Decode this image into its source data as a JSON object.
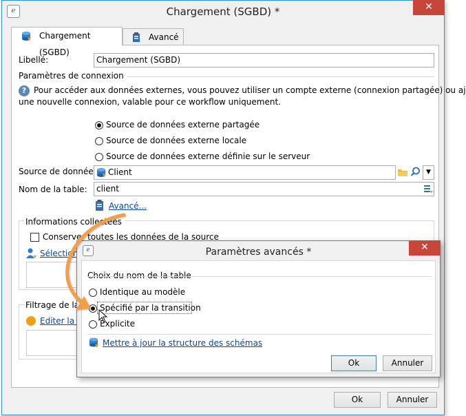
{
  "main_window": {
    "title": "Chargement (SGBD) *",
    "close_glyph": "✕",
    "tabs": [
      {
        "label": "Chargement (SGBD)",
        "icon": "database-icon"
      },
      {
        "label": "Avancé",
        "icon": "clipboard-icon"
      }
    ],
    "libelle_label": "Libellé:",
    "libelle_value": "Chargement (SGBD)",
    "connection_section": "Paramètres de connexion",
    "help_text_line1": "Pour accéder aux données externes, vous pouvez utiliser un compte externe (connexion partagée) ou ajouter",
    "help_text_line2": "une nouvelle connexion, valable pour ce workflow uniquement.",
    "radio_options": [
      {
        "label": "Source de données externe partagée",
        "checked": true
      },
      {
        "label": "Source de données externe locale",
        "checked": false
      },
      {
        "label": "Source de données externe définie sur le serveur",
        "checked": false
      }
    ],
    "datasource_label": "Source de données:",
    "datasource_value": "Client",
    "table_label": "Nom de la table:",
    "table_value": "client",
    "advanced_link": "Avancé...",
    "collected_section": "Informations collectées",
    "keep_all_checkbox": "Conserver toutes les données de la source",
    "select_link": "Sélectionner",
    "filter_section": "Filtrage de la",
    "edit_link": "Editer la re",
    "ok_label": "Ok",
    "cancel_label": "Annuler"
  },
  "advanced_dialog": {
    "title": "Paramètres avancés *",
    "close_glyph": "✕",
    "section": "Choix du nom de la table",
    "options": [
      {
        "label": "Identique au modèle",
        "checked": false
      },
      {
        "label": "Spécifié par la transition",
        "checked": true
      },
      {
        "label": "Explicite",
        "checked": false
      }
    ],
    "update_link": "Mettre à jour la structure des schémas",
    "ok_label": "Ok",
    "cancel_label": "Annuler"
  },
  "colors": {
    "accent_border": "#2b8fdb",
    "close_button": "#c7463a",
    "link": "#0645ad",
    "arrow": "#f0a04b"
  }
}
